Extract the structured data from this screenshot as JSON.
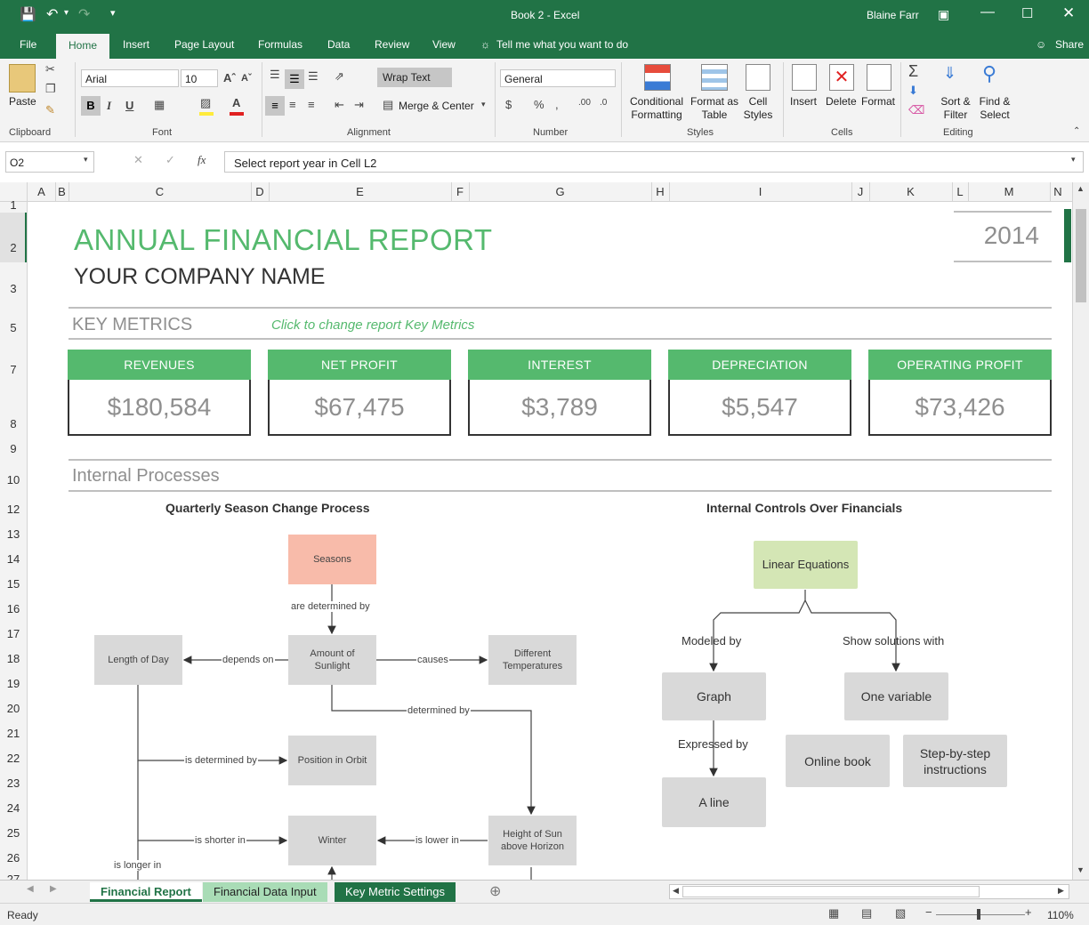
{
  "window": {
    "title": "Book 2 - Excel",
    "user": "Blaine Farr"
  },
  "tabs": [
    "File",
    "Home",
    "Insert",
    "Page Layout",
    "Formulas",
    "Data",
    "Review",
    "View"
  ],
  "tell_me": "Tell me what you want to do",
  "share": "Share",
  "ribbon": {
    "paste": "Paste",
    "font_name": "Arial",
    "font_size": "10",
    "wrap_text": "Wrap Text",
    "merge_center": "Merge & Center",
    "number_format": "General",
    "conditional": "Conditional Formatting",
    "format_table": "Format as Table",
    "cell_styles": "Cell Styles",
    "insert": "Insert",
    "delete": "Delete",
    "format": "Format",
    "sort_filter": "Sort & Filter",
    "find_select": "Find & Select",
    "groups": [
      "Clipboard",
      "Font",
      "Alignment",
      "Number",
      "Styles",
      "Cells",
      "Editing"
    ]
  },
  "formula_bar": {
    "name_box": "O2",
    "content": "Select  report year in Cell L2"
  },
  "columns": [
    "A",
    "B",
    "C",
    "D",
    "E",
    "F",
    "G",
    "H",
    "I",
    "J",
    "K",
    "L",
    "M",
    "N"
  ],
  "rows": [
    "1",
    "2",
    "3",
    "5",
    "7",
    "8",
    "9",
    "10",
    "12",
    "13",
    "14",
    "15",
    "16",
    "17",
    "18",
    "19",
    "20",
    "21",
    "22",
    "23",
    "24",
    "25",
    "26",
    "27"
  ],
  "report": {
    "title": "ANNUAL FINANCIAL REPORT",
    "company": "YOUR COMPANY NAME",
    "year": "2014",
    "key_metrics_label": "KEY METRICS",
    "key_metrics_hint": "Click to change report Key Metrics",
    "metrics": [
      {
        "label": "REVENUES",
        "value": "$180,584"
      },
      {
        "label": "NET PROFIT",
        "value": "$67,475"
      },
      {
        "label": "INTEREST",
        "value": "$3,789"
      },
      {
        "label": "DEPRECIATION",
        "value": "$5,547"
      },
      {
        "label": "OPERATING PROFIT",
        "value": "$73,426"
      }
    ],
    "internal_processes": "Internal Processes"
  },
  "diagram1": {
    "title": "Quarterly Season Change Process",
    "nodes": {
      "seasons": "Seasons",
      "sunlight": "Amount of Sunlight",
      "length_day": "Length of Day",
      "temps": "Different Temperatures",
      "orbit": "Position in Orbit",
      "winter": "Winter",
      "height_sun": "Height of Sun above Horizon"
    },
    "edges": {
      "determined_by": "are determined by",
      "depends_on": "depends on",
      "causes": "causes",
      "determined_by2": "determined by",
      "is_determined_by": "is determined by",
      "is_shorter_in": "is shorter in",
      "is_lower_in": "is lower in",
      "is_longer_in": "is longer in"
    }
  },
  "diagram2": {
    "title": "Internal Controls Over Financials",
    "nodes": {
      "linear": "Linear Equations",
      "graph": "Graph",
      "one_var": "One variable",
      "online_book": "Online book",
      "step": "Step-by-step instructions",
      "a_line": "A line"
    },
    "edges": {
      "modeled_by": "Modeled by",
      "show_solutions": "Show solutions with",
      "expressed_by": "Expressed by"
    }
  },
  "sheet_tabs": [
    "Financial Report",
    "Financial Data Input",
    "Key Metric Settings"
  ],
  "status": {
    "ready": "Ready",
    "zoom": "110%"
  },
  "colors": {
    "excel_green": "#217346",
    "accent_green": "#55b96e",
    "seasons_node": "#f8bbaa",
    "linear_node": "#d4e6b5"
  }
}
